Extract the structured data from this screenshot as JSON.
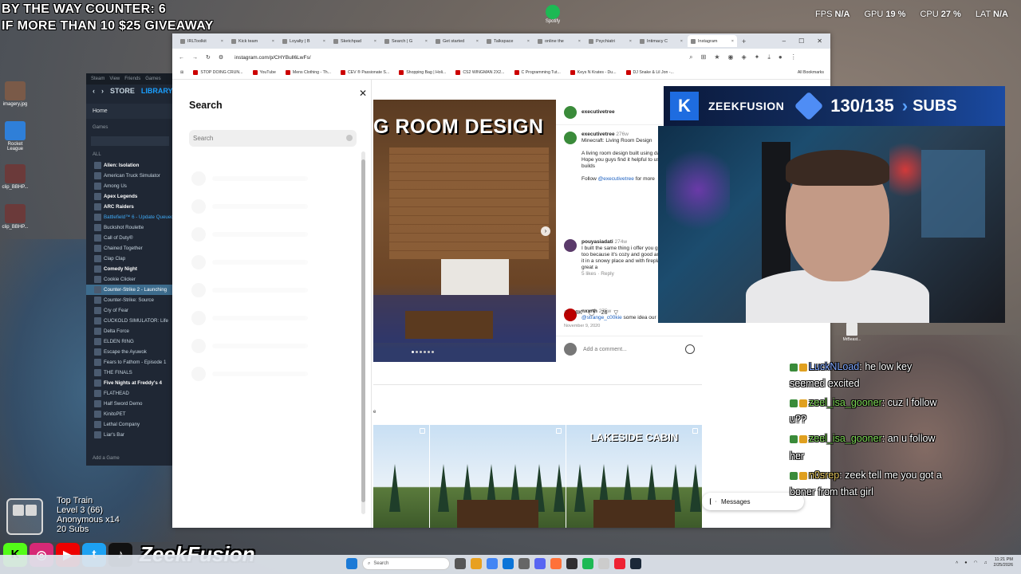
{
  "overlay": {
    "counter": "BY THE WAY COUNTER: 6",
    "giveaway": "IF MORE THAN 10 $25 GIVEAWAY"
  },
  "stats": {
    "fps_label": "FPS",
    "fps_value": "N/A",
    "gpu_label": "GPU",
    "gpu_value": "19 %",
    "cpu_label": "CPU",
    "cpu_value": "27 %",
    "lat_label": "LAT",
    "lat_value": "N/A"
  },
  "desktop_icons": [
    {
      "label": "imagery.jpg"
    },
    {
      "label": "Rocket League"
    },
    {
      "label": "clip_BBHP..."
    },
    {
      "label": "clip_BBHP..."
    }
  ],
  "spotify_label": "Spotify",
  "steam": {
    "top_items": [
      "Steam",
      "View",
      "Friends",
      "Games"
    ],
    "store": "STORE",
    "library": "LIBRARY",
    "home": "Home",
    "games_header": "Games",
    "all_label": "ALL",
    "games": [
      {
        "name": "Alien: Isolation",
        "style": "bold"
      },
      {
        "name": "American Truck Simulator",
        "style": ""
      },
      {
        "name": "Among Us",
        "style": ""
      },
      {
        "name": "Apex Legends",
        "style": "bold"
      },
      {
        "name": "ARC Raiders",
        "style": "bold"
      },
      {
        "name": "Battlefield™ 6 - Update Queued",
        "style": "update"
      },
      {
        "name": "Buckshot Roulette",
        "style": ""
      },
      {
        "name": "Call of Duty®",
        "style": ""
      },
      {
        "name": "Chained Together",
        "style": ""
      },
      {
        "name": "Clap Clap",
        "style": ""
      },
      {
        "name": "Comedy Night",
        "style": "bold"
      },
      {
        "name": "Cookie Clicker",
        "style": ""
      },
      {
        "name": "Counter-Strike 2 - Launching",
        "style": "active"
      },
      {
        "name": "Counter-Strike: Source",
        "style": ""
      },
      {
        "name": "Cry of Fear",
        "style": ""
      },
      {
        "name": "CUCKOLD SIMULATOR: Life",
        "style": ""
      },
      {
        "name": "Delta Force",
        "style": ""
      },
      {
        "name": "ELDEN RING",
        "style": ""
      },
      {
        "name": "Escape the Ayuwok",
        "style": ""
      },
      {
        "name": "Fears to Fathom - Episode 1",
        "style": ""
      },
      {
        "name": "THE FINALS",
        "style": ""
      },
      {
        "name": "Five Nights at Freddy's 4",
        "style": "bold"
      },
      {
        "name": "FLATHEAD",
        "style": ""
      },
      {
        "name": "Half Sword Demo",
        "style": ""
      },
      {
        "name": "KinitoPET",
        "style": ""
      },
      {
        "name": "Lethal Company",
        "style": ""
      },
      {
        "name": "Liar's Bar",
        "style": ""
      }
    ],
    "add_game": "Add a Game"
  },
  "browser": {
    "tabs": [
      {
        "label": "IRLToolkit"
      },
      {
        "label": "Kick team"
      },
      {
        "label": "Loyalty | B"
      },
      {
        "label": "Sketchpad"
      },
      {
        "label": "Search | G"
      },
      {
        "label": "Get started"
      },
      {
        "label": "Talkspace"
      },
      {
        "label": "online the"
      },
      {
        "label": "Psychiatri"
      },
      {
        "label": "Intimacy C"
      },
      {
        "label": "Instagram",
        "active": true
      }
    ],
    "url": "instagram.com/p/CHYBull6LwFs/",
    "bookmarks": [
      "STOP DOING CRUN...",
      "YouTube",
      "Mens Clothing - Th...",
      "CEV ® Passionate S...",
      "Shopping Bag | Holi...",
      "CS2 WINGMAN 2X2...",
      "C Programming Tut...",
      "Keys N Krates - Du...",
      "DJ Snake & Lil Jon -..."
    ],
    "all_bookmarks": "All Bookmarks"
  },
  "search_panel": {
    "title": "Search",
    "placeholder": "Search"
  },
  "post": {
    "image_title": "G ROOM DESIGN",
    "author": "executivetree",
    "caption_user": "executivetree",
    "caption_time": "276w",
    "caption_title": "Minecraft: Living Room Design",
    "caption_body": "A living room design built using dark oak blocks. Hope you guys find it helpful to use in your own builds",
    "follow_prefix": "Follow",
    "follow_link": "@executivetree",
    "follow_suffix": "for more",
    "comment1_user": "pouyasiadati",
    "comment1_time": "274w",
    "comment1_text": "I built the same thing i offer you guys too build it too because it's cozy and good and when you build it in a snowy place and with fireplace it would be great a",
    "comment1_meta": "5 likes · Reply",
    "comment2_user": "nxxrth",
    "comment2_time": "275w",
    "comment2_link": "@strange_c00kie",
    "comment2_text": "some idea our home!",
    "likes": "8K",
    "comments": "26",
    "date": "November 9, 2020",
    "add_comment": "Add a comment...",
    "more_label": "e",
    "thumb3_label": "LAKESIDE CABIN",
    "messages": "Messages"
  },
  "subs": {
    "brand": "ZEEKFUSION",
    "count": "130/135",
    "label": "SUBS"
  },
  "recycle_label": "MrBeast...",
  "chat": [
    {
      "user": "LuckNLoad",
      "msg": ": he low key seemed excited",
      "color": "#7fa7ff"
    },
    {
      "user": "zeel_isa_gooner",
      "msg": ": cuz I follow u??",
      "color": "#7ed957"
    },
    {
      "user": "zeel_isa_gooner",
      "msg": ": an u follow her",
      "color": "#7ed957"
    },
    {
      "user": "n0srep",
      "msg": ": zeek tell me you got a boner from that girl",
      "color": "#e2c35a"
    }
  ],
  "train": {
    "title": "Top Train",
    "level": "Level 3 (66)",
    "anon": "Anonymous x14",
    "subs": "20 Subs"
  },
  "social_name": "ZeekFusion",
  "taskbar": {
    "search": "Search",
    "time": "11:21 PM",
    "date": "2/25/2026"
  }
}
